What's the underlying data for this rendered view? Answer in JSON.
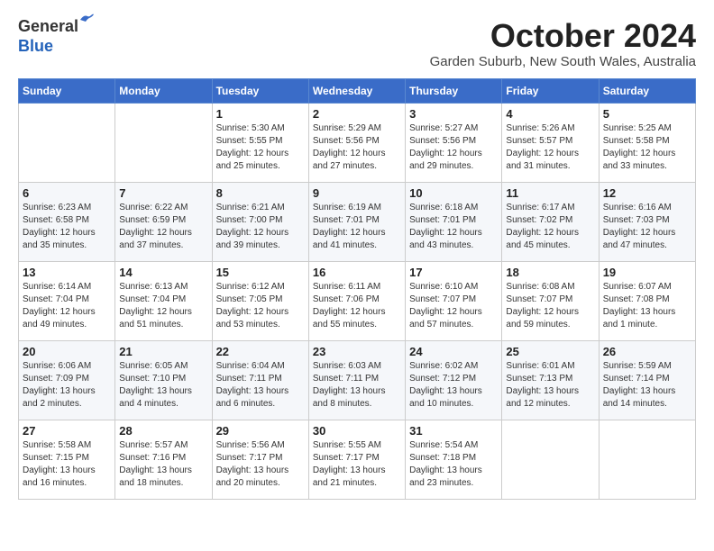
{
  "header": {
    "logo_line1": "General",
    "logo_line2": "Blue",
    "month": "October 2024",
    "location": "Garden Suburb, New South Wales, Australia"
  },
  "weekdays": [
    "Sunday",
    "Monday",
    "Tuesday",
    "Wednesday",
    "Thursday",
    "Friday",
    "Saturday"
  ],
  "weeks": [
    [
      {
        "day": "",
        "sunrise": "",
        "sunset": "",
        "daylight": ""
      },
      {
        "day": "",
        "sunrise": "",
        "sunset": "",
        "daylight": ""
      },
      {
        "day": "1",
        "sunrise": "Sunrise: 5:30 AM",
        "sunset": "Sunset: 5:55 PM",
        "daylight": "Daylight: 12 hours and 25 minutes."
      },
      {
        "day": "2",
        "sunrise": "Sunrise: 5:29 AM",
        "sunset": "Sunset: 5:56 PM",
        "daylight": "Daylight: 12 hours and 27 minutes."
      },
      {
        "day": "3",
        "sunrise": "Sunrise: 5:27 AM",
        "sunset": "Sunset: 5:56 PM",
        "daylight": "Daylight: 12 hours and 29 minutes."
      },
      {
        "day": "4",
        "sunrise": "Sunrise: 5:26 AM",
        "sunset": "Sunset: 5:57 PM",
        "daylight": "Daylight: 12 hours and 31 minutes."
      },
      {
        "day": "5",
        "sunrise": "Sunrise: 5:25 AM",
        "sunset": "Sunset: 5:58 PM",
        "daylight": "Daylight: 12 hours and 33 minutes."
      }
    ],
    [
      {
        "day": "6",
        "sunrise": "Sunrise: 6:23 AM",
        "sunset": "Sunset: 6:58 PM",
        "daylight": "Daylight: 12 hours and 35 minutes."
      },
      {
        "day": "7",
        "sunrise": "Sunrise: 6:22 AM",
        "sunset": "Sunset: 6:59 PM",
        "daylight": "Daylight: 12 hours and 37 minutes."
      },
      {
        "day": "8",
        "sunrise": "Sunrise: 6:21 AM",
        "sunset": "Sunset: 7:00 PM",
        "daylight": "Daylight: 12 hours and 39 minutes."
      },
      {
        "day": "9",
        "sunrise": "Sunrise: 6:19 AM",
        "sunset": "Sunset: 7:01 PM",
        "daylight": "Daylight: 12 hours and 41 minutes."
      },
      {
        "day": "10",
        "sunrise": "Sunrise: 6:18 AM",
        "sunset": "Sunset: 7:01 PM",
        "daylight": "Daylight: 12 hours and 43 minutes."
      },
      {
        "day": "11",
        "sunrise": "Sunrise: 6:17 AM",
        "sunset": "Sunset: 7:02 PM",
        "daylight": "Daylight: 12 hours and 45 minutes."
      },
      {
        "day": "12",
        "sunrise": "Sunrise: 6:16 AM",
        "sunset": "Sunset: 7:03 PM",
        "daylight": "Daylight: 12 hours and 47 minutes."
      }
    ],
    [
      {
        "day": "13",
        "sunrise": "Sunrise: 6:14 AM",
        "sunset": "Sunset: 7:04 PM",
        "daylight": "Daylight: 12 hours and 49 minutes."
      },
      {
        "day": "14",
        "sunrise": "Sunrise: 6:13 AM",
        "sunset": "Sunset: 7:04 PM",
        "daylight": "Daylight: 12 hours and 51 minutes."
      },
      {
        "day": "15",
        "sunrise": "Sunrise: 6:12 AM",
        "sunset": "Sunset: 7:05 PM",
        "daylight": "Daylight: 12 hours and 53 minutes."
      },
      {
        "day": "16",
        "sunrise": "Sunrise: 6:11 AM",
        "sunset": "Sunset: 7:06 PM",
        "daylight": "Daylight: 12 hours and 55 minutes."
      },
      {
        "day": "17",
        "sunrise": "Sunrise: 6:10 AM",
        "sunset": "Sunset: 7:07 PM",
        "daylight": "Daylight: 12 hours and 57 minutes."
      },
      {
        "day": "18",
        "sunrise": "Sunrise: 6:08 AM",
        "sunset": "Sunset: 7:07 PM",
        "daylight": "Daylight: 12 hours and 59 minutes."
      },
      {
        "day": "19",
        "sunrise": "Sunrise: 6:07 AM",
        "sunset": "Sunset: 7:08 PM",
        "daylight": "Daylight: 13 hours and 1 minute."
      }
    ],
    [
      {
        "day": "20",
        "sunrise": "Sunrise: 6:06 AM",
        "sunset": "Sunset: 7:09 PM",
        "daylight": "Daylight: 13 hours and 2 minutes."
      },
      {
        "day": "21",
        "sunrise": "Sunrise: 6:05 AM",
        "sunset": "Sunset: 7:10 PM",
        "daylight": "Daylight: 13 hours and 4 minutes."
      },
      {
        "day": "22",
        "sunrise": "Sunrise: 6:04 AM",
        "sunset": "Sunset: 7:11 PM",
        "daylight": "Daylight: 13 hours and 6 minutes."
      },
      {
        "day": "23",
        "sunrise": "Sunrise: 6:03 AM",
        "sunset": "Sunset: 7:11 PM",
        "daylight": "Daylight: 13 hours and 8 minutes."
      },
      {
        "day": "24",
        "sunrise": "Sunrise: 6:02 AM",
        "sunset": "Sunset: 7:12 PM",
        "daylight": "Daylight: 13 hours and 10 minutes."
      },
      {
        "day": "25",
        "sunrise": "Sunrise: 6:01 AM",
        "sunset": "Sunset: 7:13 PM",
        "daylight": "Daylight: 13 hours and 12 minutes."
      },
      {
        "day": "26",
        "sunrise": "Sunrise: 5:59 AM",
        "sunset": "Sunset: 7:14 PM",
        "daylight": "Daylight: 13 hours and 14 minutes."
      }
    ],
    [
      {
        "day": "27",
        "sunrise": "Sunrise: 5:58 AM",
        "sunset": "Sunset: 7:15 PM",
        "daylight": "Daylight: 13 hours and 16 minutes."
      },
      {
        "day": "28",
        "sunrise": "Sunrise: 5:57 AM",
        "sunset": "Sunset: 7:16 PM",
        "daylight": "Daylight: 13 hours and 18 minutes."
      },
      {
        "day": "29",
        "sunrise": "Sunrise: 5:56 AM",
        "sunset": "Sunset: 7:17 PM",
        "daylight": "Daylight: 13 hours and 20 minutes."
      },
      {
        "day": "30",
        "sunrise": "Sunrise: 5:55 AM",
        "sunset": "Sunset: 7:17 PM",
        "daylight": "Daylight: 13 hours and 21 minutes."
      },
      {
        "day": "31",
        "sunrise": "Sunrise: 5:54 AM",
        "sunset": "Sunset: 7:18 PM",
        "daylight": "Daylight: 13 hours and 23 minutes."
      },
      {
        "day": "",
        "sunrise": "",
        "sunset": "",
        "daylight": ""
      },
      {
        "day": "",
        "sunrise": "",
        "sunset": "",
        "daylight": ""
      }
    ]
  ]
}
